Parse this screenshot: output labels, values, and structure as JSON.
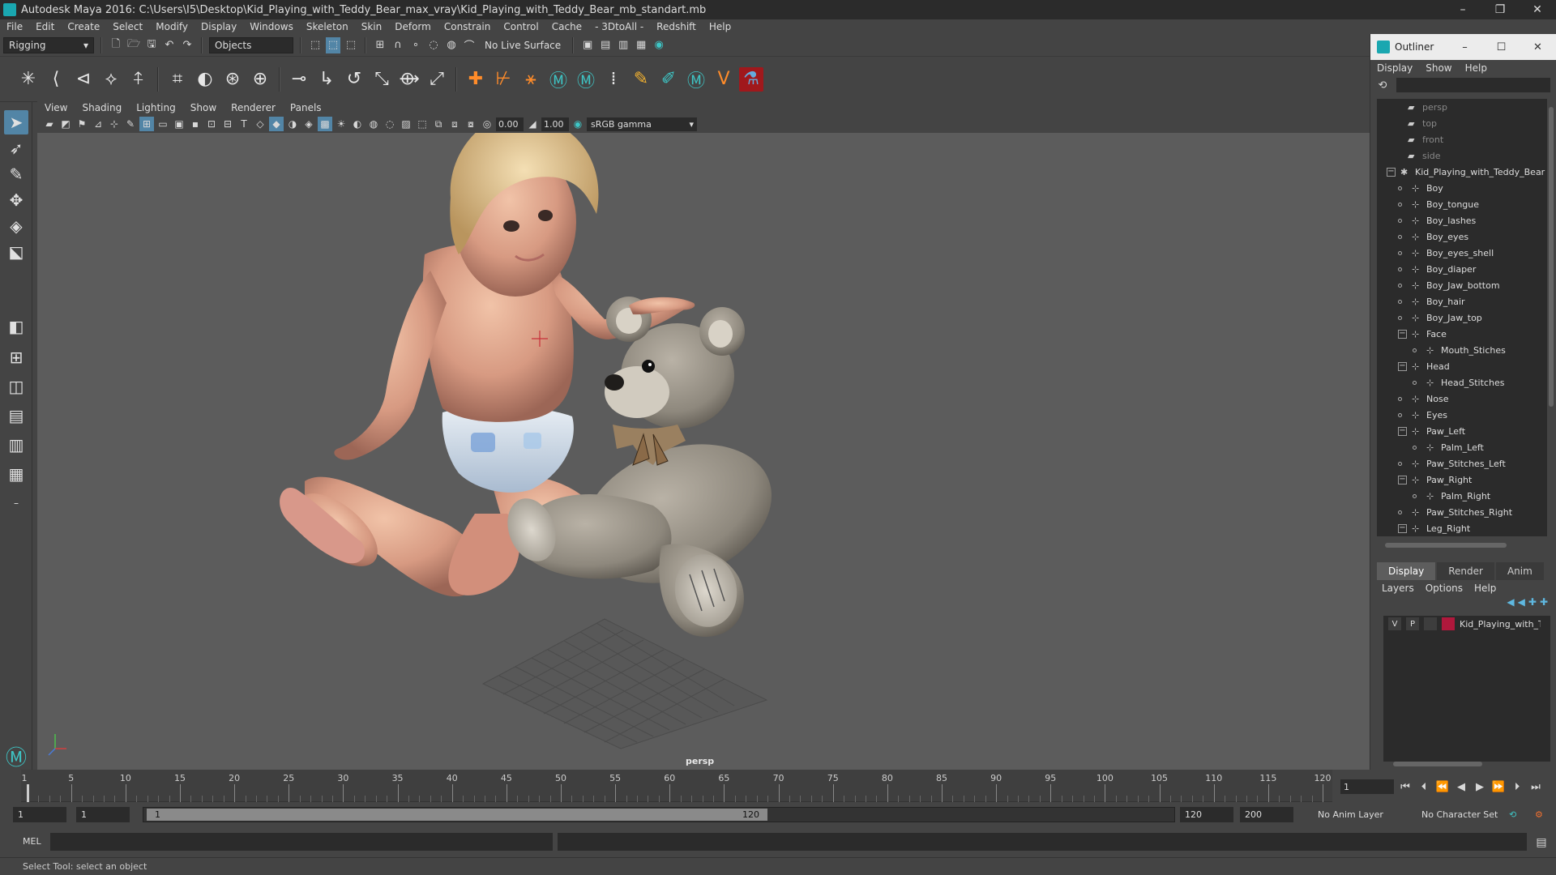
{
  "window": {
    "title": "Autodesk Maya 2016: C:\\Users\\I5\\Desktop\\Kid_Playing_with_Teddy_Bear_max_vray\\Kid_Playing_with_Teddy_Bear_mb_standart.mb",
    "minimize": "–",
    "maximize": "❐",
    "close": "✕"
  },
  "menu": [
    "File",
    "Edit",
    "Create",
    "Select",
    "Modify",
    "Display",
    "Windows",
    "Skeleton",
    "Skin",
    "Deform",
    "Constrain",
    "Control",
    "Cache",
    "- 3DtoAll -",
    "Redshift",
    "Help"
  ],
  "status": {
    "mode": "Rigging",
    "selection_mode": "Objects",
    "live_surface": "No Live Surface"
  },
  "viewport": {
    "menu": [
      "View",
      "Shading",
      "Lighting",
      "Show",
      "Renderer",
      "Panels"
    ],
    "exposure": "0.00",
    "gamma_value": "1.00",
    "color_space": "sRGB gamma",
    "camera": "persp"
  },
  "outliner": {
    "title": "Outliner",
    "menu": [
      "Display",
      "Show",
      "Help"
    ],
    "items": [
      {
        "label": "persp",
        "level": 0,
        "type": "camera",
        "dim": true
      },
      {
        "label": "top",
        "level": 0,
        "type": "camera",
        "dim": true
      },
      {
        "label": "front",
        "level": 0,
        "type": "camera",
        "dim": true
      },
      {
        "label": "side",
        "level": 0,
        "type": "camera",
        "dim": true
      },
      {
        "label": "Kid_Playing_with_Teddy_Bear",
        "level": 0,
        "type": "group",
        "expanded": true
      },
      {
        "label": "Boy",
        "level": 1,
        "type": "mesh"
      },
      {
        "label": "Boy_tongue",
        "level": 1,
        "type": "mesh"
      },
      {
        "label": "Boy_lashes",
        "level": 1,
        "type": "mesh"
      },
      {
        "label": "Boy_eyes",
        "level": 1,
        "type": "mesh"
      },
      {
        "label": "Boy_eyes_shell",
        "level": 1,
        "type": "mesh"
      },
      {
        "label": "Boy_diaper",
        "level": 1,
        "type": "mesh"
      },
      {
        "label": "Boy_Jaw_bottom",
        "level": 1,
        "type": "mesh"
      },
      {
        "label": "Boy_hair",
        "level": 1,
        "type": "mesh"
      },
      {
        "label": "Boy_Jaw_top",
        "level": 1,
        "type": "mesh"
      },
      {
        "label": "Face",
        "level": 1,
        "type": "mesh",
        "expanded": true
      },
      {
        "label": "Mouth_Stiches",
        "level": 2,
        "type": "mesh"
      },
      {
        "label": "Head",
        "level": 1,
        "type": "mesh",
        "expanded": true
      },
      {
        "label": "Head_Stitches",
        "level": 2,
        "type": "mesh"
      },
      {
        "label": "Nose",
        "level": 1,
        "type": "mesh"
      },
      {
        "label": "Eyes",
        "level": 1,
        "type": "mesh"
      },
      {
        "label": "Paw_Left",
        "level": 1,
        "type": "mesh",
        "expanded": true
      },
      {
        "label": "Palm_Left",
        "level": 2,
        "type": "mesh"
      },
      {
        "label": "Paw_Stitches_Left",
        "level": 1,
        "type": "mesh"
      },
      {
        "label": "Paw_Right",
        "level": 1,
        "type": "mesh",
        "expanded": true
      },
      {
        "label": "Palm_Right",
        "level": 2,
        "type": "mesh"
      },
      {
        "label": "Paw_Stitches_Right",
        "level": 1,
        "type": "mesh"
      },
      {
        "label": "Leg_Right",
        "level": 1,
        "type": "mesh",
        "expanded": true
      }
    ]
  },
  "layers": {
    "tabs": [
      "Display",
      "Render",
      "Anim"
    ],
    "active_tab": "Display",
    "menu": [
      "Layers",
      "Options",
      "Help"
    ],
    "rows": [
      {
        "visible": "V",
        "playback": "P",
        "name": "Kid_Playing_with_Teddy_Bear",
        "color": "#b0183c"
      }
    ]
  },
  "timeline": {
    "ticks": [
      5,
      10,
      15,
      20,
      25,
      30,
      35,
      40,
      45,
      50,
      55,
      60,
      65,
      70,
      75,
      80,
      85,
      90,
      95,
      100,
      105,
      110,
      115,
      120
    ],
    "first_label": "1",
    "current_frame": "1"
  },
  "range": {
    "start": "1",
    "playback_start": "1",
    "slider_start": "1",
    "slider_end": "120",
    "playback_end": "120",
    "end": "200",
    "anim_layer": "No Anim Layer",
    "character_set": "No Character Set"
  },
  "command": {
    "label": "MEL"
  },
  "help": {
    "text": "Select Tool: select an object"
  }
}
